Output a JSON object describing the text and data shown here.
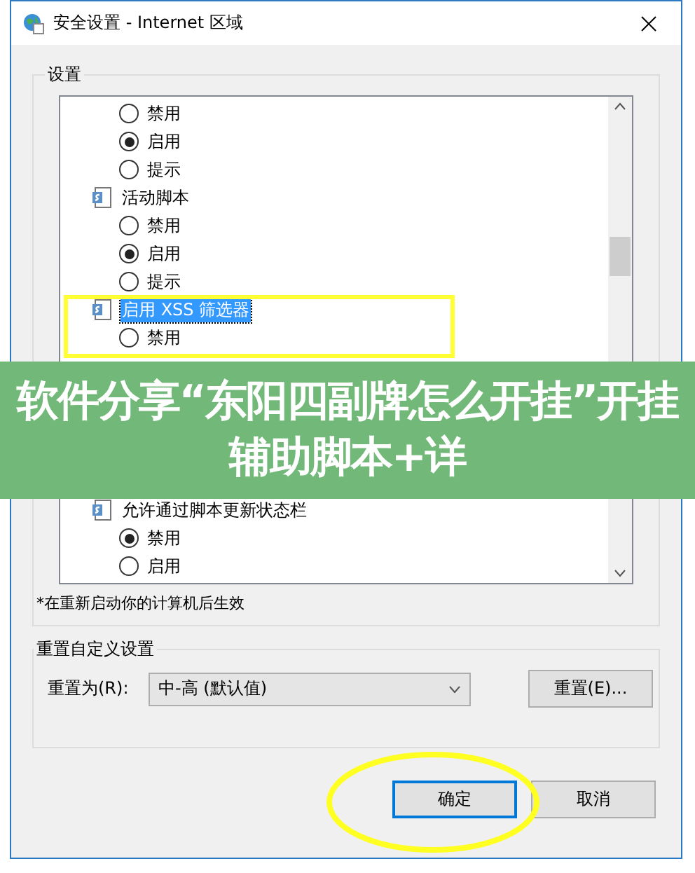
{
  "window": {
    "title": "安全设置 - Internet 区域"
  },
  "settings": {
    "label": "设置",
    "items": [
      {
        "kind": "radio",
        "label": "禁用",
        "selected": false
      },
      {
        "kind": "radio",
        "label": "启用",
        "selected": true
      },
      {
        "kind": "radio",
        "label": "提示",
        "selected": false
      },
      {
        "kind": "group",
        "label": "活动脚本",
        "selected": false
      },
      {
        "kind": "radio",
        "label": "禁用",
        "selected": false
      },
      {
        "kind": "radio",
        "label": "启用",
        "selected": true
      },
      {
        "kind": "radio",
        "label": "提示",
        "selected": false
      },
      {
        "kind": "group",
        "label": "启用 XSS 筛选器",
        "selected": true
      },
      {
        "kind": "radio",
        "label": "禁用",
        "selected": false
      },
      {
        "kind": "gap"
      },
      {
        "kind": "group",
        "label": "允许通过脚本更新状态栏",
        "selected": false
      },
      {
        "kind": "radio",
        "label": "禁用",
        "selected": true
      },
      {
        "kind": "radio",
        "label": "启用",
        "selected": false
      }
    ],
    "note": "*在重新启动你的计算机后生效"
  },
  "reset": {
    "label": "重置自定义设置",
    "field_label": "重置为(R):",
    "value": "中-高 (默认值)",
    "button": "重置(E)..."
  },
  "buttons": [
    {
      "label": "确定",
      "default": true
    },
    {
      "label": "取消",
      "default": false
    }
  ],
  "banner": {
    "text": "软件分享“东阳四副牌怎么开挂”开挂辅助脚本+详"
  }
}
